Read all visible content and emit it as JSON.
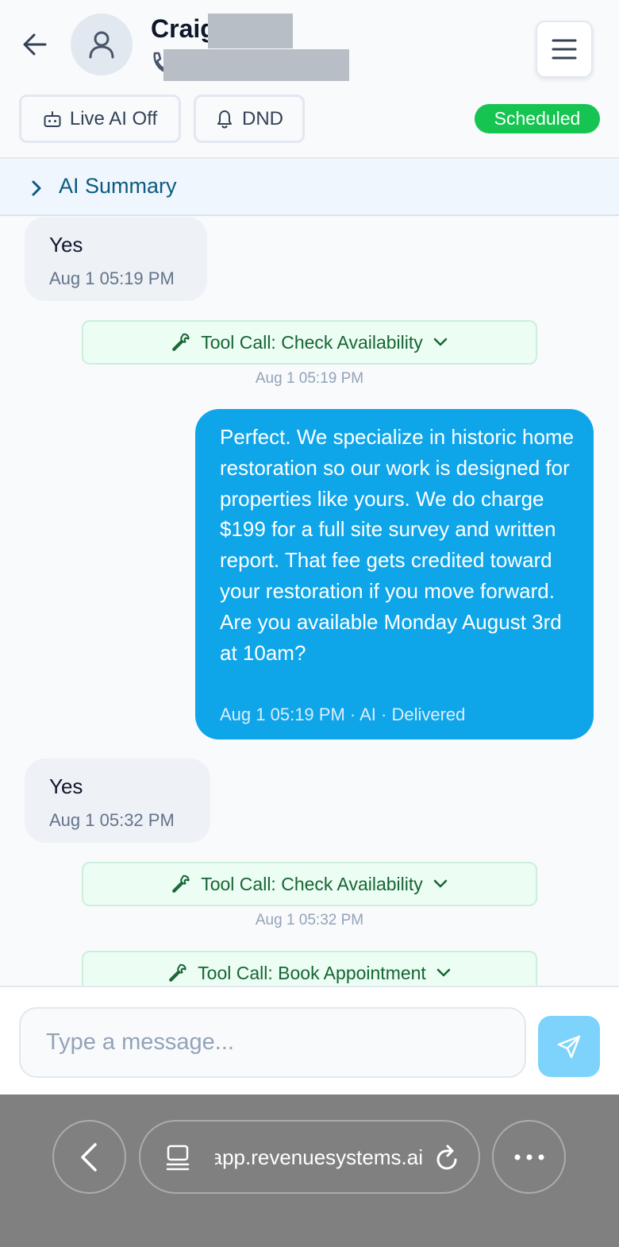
{
  "header": {
    "contact_name": "Craig",
    "live_ai_label": "Live AI Off",
    "dnd_label": "DND",
    "status_badge": "Scheduled"
  },
  "summary": {
    "label": "AI Summary"
  },
  "messages": {
    "m1": {
      "text": "Yes",
      "time": "Aug 1 05:19 PM"
    },
    "tool1": {
      "label": "Tool Call: Check Availability",
      "time": "Aug 1 05:19 PM"
    },
    "m2": {
      "text": "Perfect. We specialize in historic home restoration so our work is designed for properties like yours. We do charge $199 for a full site survey and written report. That fee gets credited toward your restoration if you move forward. Are you available Monday August 3rd at 10am?",
      "meta": "Aug 1 05:19 PM · AI · Delivered"
    },
    "m3": {
      "text": "Yes",
      "time": "Aug 1 05:32 PM"
    },
    "tool2": {
      "label": "Tool Call: Check Availability",
      "time": "Aug 1 05:32 PM"
    },
    "tool3": {
      "label": "Tool Call: Book Appointment"
    }
  },
  "composer": {
    "placeholder": "Type a message..."
  },
  "browser": {
    "url": "app.revenuesystems.ai"
  },
  "colors": {
    "accent": "#0ea5e9",
    "status_green": "#16c451",
    "tool_green": "#166534",
    "summary_text": "#0c5a80"
  },
  "icons": [
    "back-arrow-icon",
    "user-icon",
    "phone-icon",
    "menu-icon",
    "robot-icon",
    "bell-icon",
    "chevron-right-icon",
    "wrench-icon",
    "chevron-down-icon",
    "send-icon",
    "tabs-icon",
    "reload-icon",
    "more-icon"
  ]
}
